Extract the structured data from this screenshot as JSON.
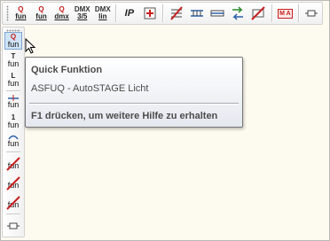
{
  "toolbar": {
    "buttons": [
      {
        "top": "Q",
        "bot": "fun"
      },
      {
        "top": "Q",
        "bot": "fun"
      },
      {
        "top": "Q",
        "bot": "dmx"
      },
      {
        "top": "DMX",
        "bot": "3/5"
      },
      {
        "top": "DMX",
        "bot": "lin"
      },
      {
        "top": "IP",
        "bot": ""
      }
    ],
    "m_a_label": "M A"
  },
  "vbar": {
    "buttons": [
      {
        "top": "Q",
        "bot": "fun"
      },
      {
        "top": "T",
        "bot": "fun"
      },
      {
        "top": "L",
        "bot": "fun"
      },
      {
        "top": "",
        "bot": "fun"
      },
      {
        "top": "1",
        "bot": "fun"
      },
      {
        "top": "",
        "bot": "fun"
      },
      {
        "top": "",
        "bot": "fun"
      },
      {
        "top": "",
        "bot": "fun"
      },
      {
        "top": "",
        "bot": "fun"
      }
    ]
  },
  "tooltip": {
    "title": "Quick Funktion",
    "description": "ASFUQ - AutoSTAGE Licht",
    "help": "F1 drücken, um weitere Hilfe zu erhalten"
  },
  "colors": {
    "accent_red": "#c81e1e",
    "highlight": "#cfe4f8",
    "background": "#fdfaf0"
  }
}
